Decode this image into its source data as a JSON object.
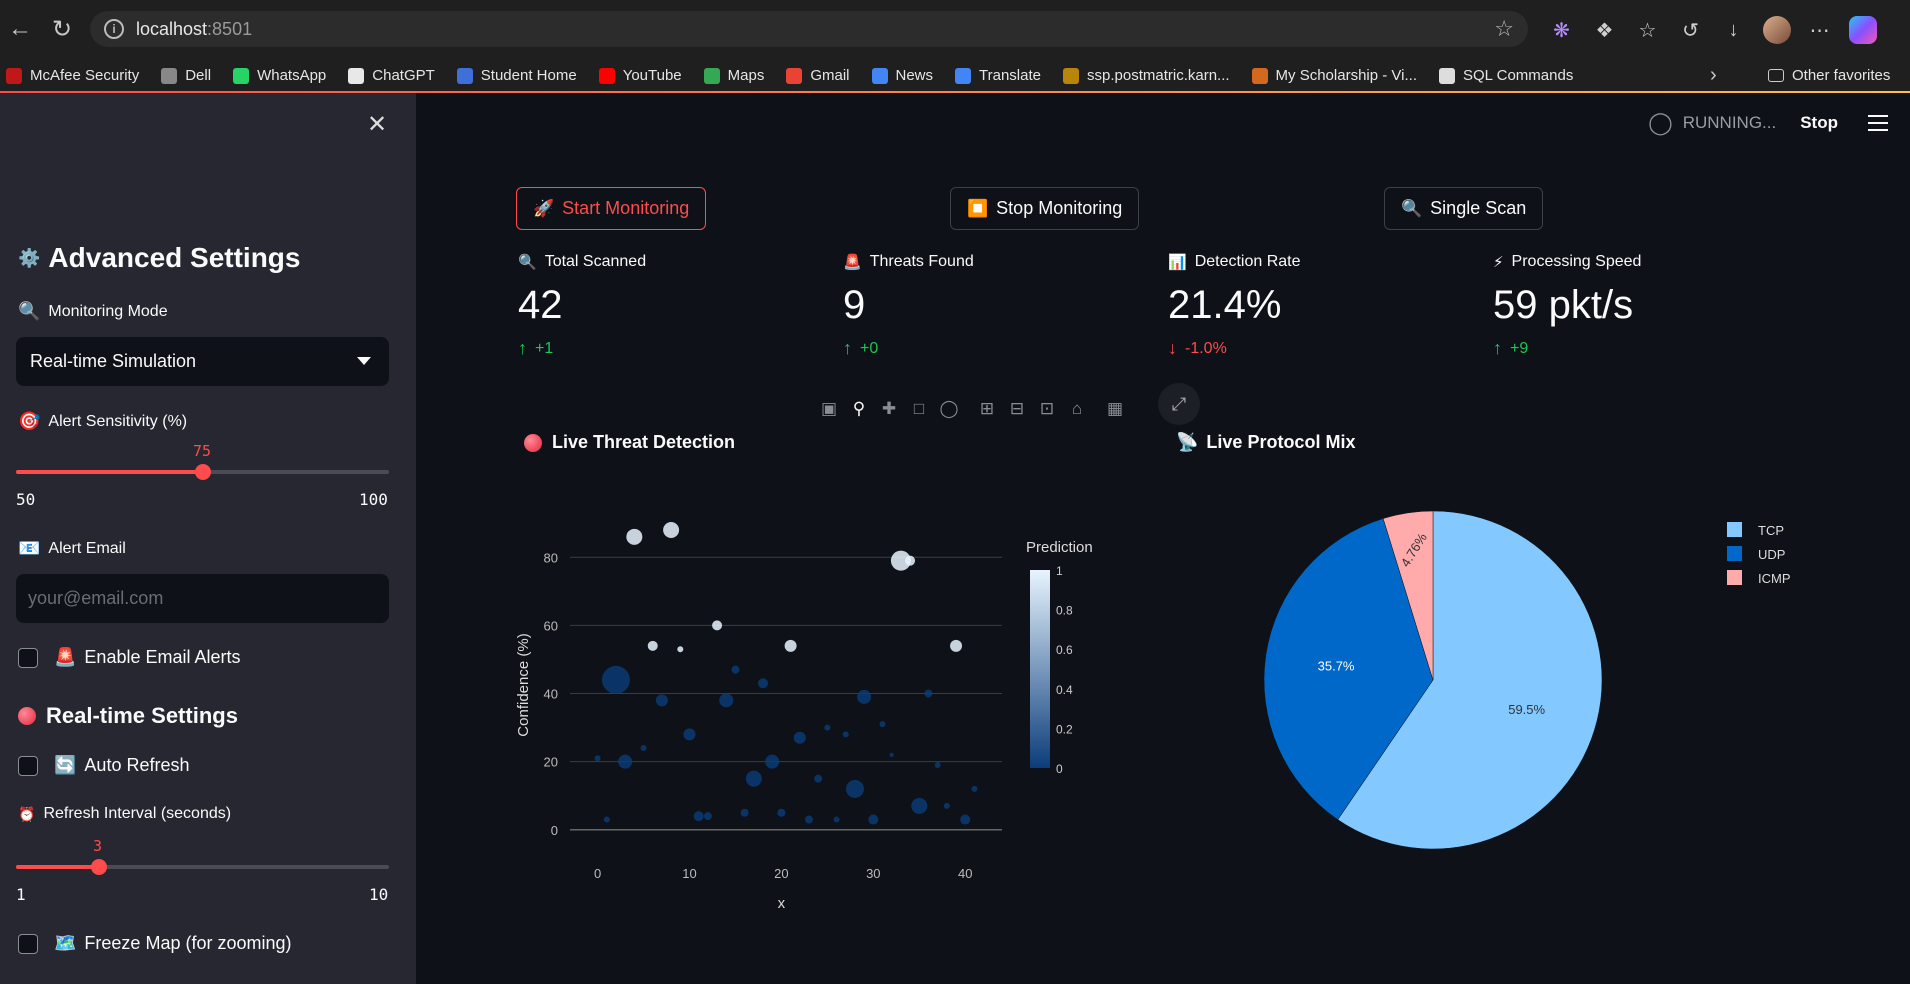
{
  "browser": {
    "url_host": "localhost",
    "url_port": ":8501",
    "bookmarks": [
      {
        "label": "McAfee Security",
        "color": "#c01818"
      },
      {
        "label": "Dell",
        "color": "#888888"
      },
      {
        "label": "WhatsApp",
        "color": "#25d366"
      },
      {
        "label": "ChatGPT",
        "color": "#e8e8e8"
      },
      {
        "label": "Student Home",
        "color": "#3f6fd8"
      },
      {
        "label": "YouTube",
        "color": "#ff0000"
      },
      {
        "label": "Maps",
        "color": "#34a853"
      },
      {
        "label": "Gmail",
        "color": "#ea4335"
      },
      {
        "label": "News",
        "color": "#4285f4"
      },
      {
        "label": "Translate",
        "color": "#4285f4"
      },
      {
        "label": "ssp.postmatric.karn...",
        "color": "#b8860b"
      },
      {
        "label": "My Scholarship - Vi...",
        "color": "#d2691e"
      },
      {
        "label": "SQL Commands",
        "color": "#dddddd"
      }
    ],
    "other_favorites": "Other favorites"
  },
  "sidebar": {
    "title": "Advanced Settings",
    "title_icon": "⚙️",
    "monitoring_mode": {
      "label": "Monitoring Mode",
      "icon": "🔍",
      "value": "Real-time Simulation"
    },
    "alert_sensitivity": {
      "label": "Alert Sensitivity (%)",
      "icon": "🎯",
      "value": 75,
      "min": 50,
      "max": 100
    },
    "alert_email": {
      "label": "Alert Email",
      "icon": "📧",
      "placeholder": "your@email.com"
    },
    "enable_email_alerts": {
      "label": "Enable Email Alerts",
      "icon": "🚨"
    },
    "realtime_title": "Real-time Settings",
    "auto_refresh": {
      "label": "Auto Refresh",
      "icon": "🔄"
    },
    "refresh_interval": {
      "label": "Refresh Interval (seconds)",
      "icon": "⏰",
      "value": 3,
      "min": 1,
      "max": 10
    },
    "freeze_map": {
      "label": "Freeze Map (for zooming)",
      "icon": "🗺️"
    }
  },
  "header": {
    "status": "RUNNING...",
    "stop_label": "Stop"
  },
  "buttons": {
    "start": {
      "label": "Start Monitoring",
      "icon": "🚀"
    },
    "stop": {
      "label": "Stop Monitoring",
      "icon": "⏹️"
    },
    "scan": {
      "label": "Single Scan",
      "icon": "🔍"
    }
  },
  "metrics": [
    {
      "label": "Total Scanned",
      "icon": "🔍",
      "value": "42",
      "delta": "+1",
      "direction": "up"
    },
    {
      "label": "Threats Found",
      "icon": "🚨",
      "value": "9",
      "delta": "+0",
      "direction": "up"
    },
    {
      "label": "Detection Rate",
      "icon": "📊",
      "value": "21.4%",
      "delta": "-1.0%",
      "direction": "down"
    },
    {
      "label": "Processing Speed",
      "icon": "⚡",
      "value": "59 pkt/s",
      "delta": "+9",
      "direction": "up"
    }
  ],
  "chart_data": [
    {
      "type": "scatter",
      "title": "Live Threat Detection",
      "xlabel": "x",
      "ylabel": "Confidence (%)",
      "xlim": [
        -3,
        44
      ],
      "ylim": [
        -3,
        88
      ],
      "xticks": [
        0,
        10,
        20,
        30,
        40
      ],
      "yticks": [
        0,
        20,
        40,
        60,
        80
      ],
      "colorbar": {
        "title": "Prediction",
        "ticks": [
          0,
          0.2,
          0.4,
          0.6,
          0.8,
          1
        ]
      },
      "points": [
        {
          "x": 1,
          "y": 3,
          "s": 3,
          "c": 0
        },
        {
          "x": 0,
          "y": 21,
          "s": 3,
          "c": 0
        },
        {
          "x": 2,
          "y": 44,
          "s": 14,
          "c": 0
        },
        {
          "x": 3,
          "y": 20,
          "s": 7,
          "c": 0
        },
        {
          "x": 4,
          "y": 86,
          "s": 8,
          "c": 1
        },
        {
          "x": 5,
          "y": 24,
          "s": 3,
          "c": 0
        },
        {
          "x": 6,
          "y": 54,
          "s": 5,
          "c": 1
        },
        {
          "x": 7,
          "y": 38,
          "s": 6,
          "c": 0
        },
        {
          "x": 8,
          "y": 88,
          "s": 8,
          "c": 1
        },
        {
          "x": 9,
          "y": 53,
          "s": 3,
          "c": 1
        },
        {
          "x": 10,
          "y": 28,
          "s": 6,
          "c": 0
        },
        {
          "x": 11,
          "y": 4,
          "s": 5,
          "c": 0
        },
        {
          "x": 12,
          "y": 4,
          "s": 4,
          "c": 0
        },
        {
          "x": 13,
          "y": 60,
          "s": 5,
          "c": 1
        },
        {
          "x": 14,
          "y": 38,
          "s": 7,
          "c": 0
        },
        {
          "x": 15,
          "y": 47,
          "s": 4,
          "c": 0
        },
        {
          "x": 16,
          "y": 5,
          "s": 4,
          "c": 0
        },
        {
          "x": 17,
          "y": 15,
          "s": 8,
          "c": 0
        },
        {
          "x": 18,
          "y": 43,
          "s": 5,
          "c": 0
        },
        {
          "x": 19,
          "y": 20,
          "s": 7,
          "c": 0
        },
        {
          "x": 20,
          "y": 5,
          "s": 4,
          "c": 0
        },
        {
          "x": 21,
          "y": 54,
          "s": 6,
          "c": 1
        },
        {
          "x": 22,
          "y": 27,
          "s": 6,
          "c": 0
        },
        {
          "x": 23,
          "y": 3,
          "s": 4,
          "c": 0
        },
        {
          "x": 24,
          "y": 15,
          "s": 4,
          "c": 0
        },
        {
          "x": 25,
          "y": 30,
          "s": 3,
          "c": 0
        },
        {
          "x": 26,
          "y": 3,
          "s": 3,
          "c": 0
        },
        {
          "x": 27,
          "y": 28,
          "s": 3,
          "c": 0
        },
        {
          "x": 28,
          "y": 12,
          "s": 9,
          "c": 0
        },
        {
          "x": 29,
          "y": 39,
          "s": 7,
          "c": 0
        },
        {
          "x": 30,
          "y": 3,
          "s": 5,
          "c": 0
        },
        {
          "x": 31,
          "y": 31,
          "s": 3,
          "c": 0
        },
        {
          "x": 32,
          "y": 22,
          "s": 2,
          "c": 0
        },
        {
          "x": 33,
          "y": 79,
          "s": 10,
          "c": 1
        },
        {
          "x": 34,
          "y": 79,
          "s": 5,
          "c": 1
        },
        {
          "x": 35,
          "y": 7,
          "s": 8,
          "c": 0
        },
        {
          "x": 36,
          "y": 40,
          "s": 4,
          "c": 0
        },
        {
          "x": 37,
          "y": 19,
          "s": 3,
          "c": 0
        },
        {
          "x": 38,
          "y": 7,
          "s": 3,
          "c": 0
        },
        {
          "x": 39,
          "y": 54,
          "s": 6,
          "c": 1
        },
        {
          "x": 40,
          "y": 3,
          "s": 5,
          "c": 0
        },
        {
          "x": 41,
          "y": 12,
          "s": 3,
          "c": 0
        }
      ]
    },
    {
      "type": "pie",
      "title": "Live Protocol Mix",
      "title_icon": "📡",
      "labels": [
        "TCP",
        "UDP",
        "ICMP"
      ],
      "values": [
        59.5,
        35.7,
        4.76
      ],
      "display": [
        "59.5%",
        "35.7%",
        "4.76%"
      ],
      "colors": [
        "#83c9ff",
        "#0068c9",
        "#ffabab"
      ]
    }
  ]
}
